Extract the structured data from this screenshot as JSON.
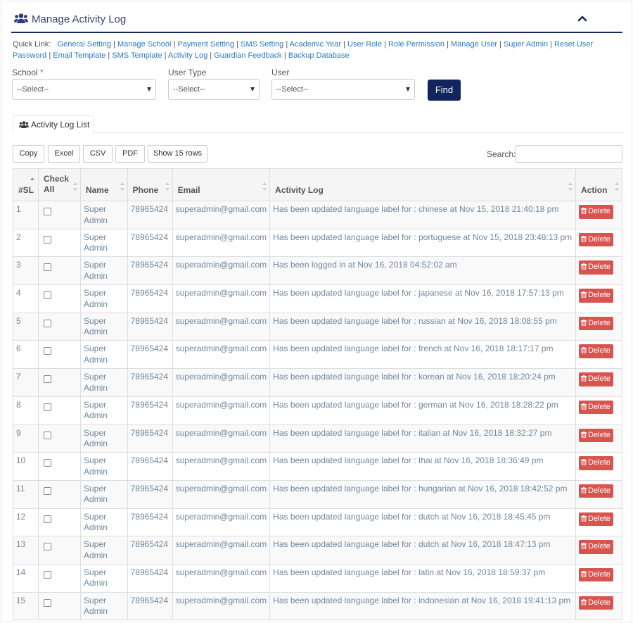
{
  "header": {
    "title": "Manage Activity Log"
  },
  "quick_links": {
    "label": "Quick Link:",
    "items": [
      "General Setting",
      "Manage School",
      "Payment Setting",
      "SMS Setting",
      "Academic Year",
      "User Role",
      "Role Permission",
      "Manage User",
      "Super Admin",
      "Reset User Password",
      "Email Template",
      "SMS Template",
      "Activity Log",
      "Guardian Feedback",
      "Backup Database"
    ]
  },
  "filters": {
    "school_label": "School",
    "required_mark": "*",
    "school_value": "--Select--",
    "user_type_label": "User Type",
    "user_type_value": "--Select--",
    "user_label": "User",
    "user_value": "--Select--",
    "find_label": "Find"
  },
  "tab": {
    "label": "Activity Log List"
  },
  "toolbar": {
    "copy": "Copy",
    "excel": "Excel",
    "csv": "CSV",
    "pdf": "PDF",
    "show_rows": "Show 15 rows",
    "search_label": "Search:",
    "search_value": ""
  },
  "table": {
    "columns": [
      "#SL",
      "Check All",
      "Name",
      "Phone",
      "Email",
      "Activity Log",
      "Action"
    ],
    "delete_label": "Delete",
    "rows": [
      {
        "sl": "1",
        "name": "Super Admin",
        "phone": "78965424",
        "email": "superadmin@gmail.com",
        "log": "Has been updated language label for : chinese at Nov 15, 2018 21:40:18 pm"
      },
      {
        "sl": "2",
        "name": "Super Admin",
        "phone": "78965424",
        "email": "superadmin@gmail.com",
        "log": "Has been updated language label for : portuguese at Nov 15, 2018 23:48:13 pm"
      },
      {
        "sl": "3",
        "name": "Super Admin",
        "phone": "78965424",
        "email": "superadmin@gmail.com",
        "log": "Has been logged in at Nov 16, 2018 04:52:02 am"
      },
      {
        "sl": "4",
        "name": "Super Admin",
        "phone": "78965424",
        "email": "superadmin@gmail.com",
        "log": "Has been updated language label for : japanese at Nov 16, 2018 17:57:13 pm"
      },
      {
        "sl": "5",
        "name": "Super Admin",
        "phone": "78965424",
        "email": "superadmin@gmail.com",
        "log": "Has been updated language label for : russian at Nov 16, 2018 18:08:55 pm"
      },
      {
        "sl": "6",
        "name": "Super Admin",
        "phone": "78965424",
        "email": "superadmin@gmail.com",
        "log": "Has been updated language label for : french at Nov 16, 2018 18:17:17 pm"
      },
      {
        "sl": "7",
        "name": "Super Admin",
        "phone": "78965424",
        "email": "superadmin@gmail.com",
        "log": "Has been updated language label for : korean at Nov 16, 2018 18:20:24 pm"
      },
      {
        "sl": "8",
        "name": "Super Admin",
        "phone": "78965424",
        "email": "superadmin@gmail.com",
        "log": "Has been updated language label for : german at Nov 16, 2018 18:28:22 pm"
      },
      {
        "sl": "9",
        "name": "Super Admin",
        "phone": "78965424",
        "email": "superadmin@gmail.com",
        "log": "Has been updated language label for : italian at Nov 16, 2018 18:32:27 pm"
      },
      {
        "sl": "10",
        "name": "Super Admin",
        "phone": "78965424",
        "email": "superadmin@gmail.com",
        "log": "Has been updated language label for : thai at Nov 16, 2018 18:36:49 pm"
      },
      {
        "sl": "11",
        "name": "Super Admin",
        "phone": "78965424",
        "email": "superadmin@gmail.com",
        "log": "Has been updated language label for : hungarian at Nov 16, 2018 18:42:52 pm"
      },
      {
        "sl": "12",
        "name": "Super Admin",
        "phone": "78965424",
        "email": "superadmin@gmail.com",
        "log": "Has been updated language label for : dutch at Nov 16, 2018 18:45:45 pm"
      },
      {
        "sl": "13",
        "name": "Super Admin",
        "phone": "78965424",
        "email": "superadmin@gmail.com",
        "log": "Has been updated language label for : dutch at Nov 16, 2018 18:47:13 pm"
      },
      {
        "sl": "14",
        "name": "Super Admin",
        "phone": "78965424",
        "email": "superadmin@gmail.com",
        "log": "Has been updated language label for : latin at Nov 16, 2018 18:59:37 pm"
      },
      {
        "sl": "15",
        "name": "Super Admin",
        "phone": "78965424",
        "email": "superadmin@gmail.com",
        "log": "Has been updated language label for : indonesian at Nov 16, 2018 19:41:13 pm"
      }
    ]
  },
  "colors": {
    "accent": "#12245e",
    "link": "#2a7bc0",
    "danger": "#d9534f"
  },
  "icons": {
    "title": "users-icon",
    "collapse": "chevron-up-icon",
    "tab": "users-icon",
    "delete": "trash-icon"
  }
}
